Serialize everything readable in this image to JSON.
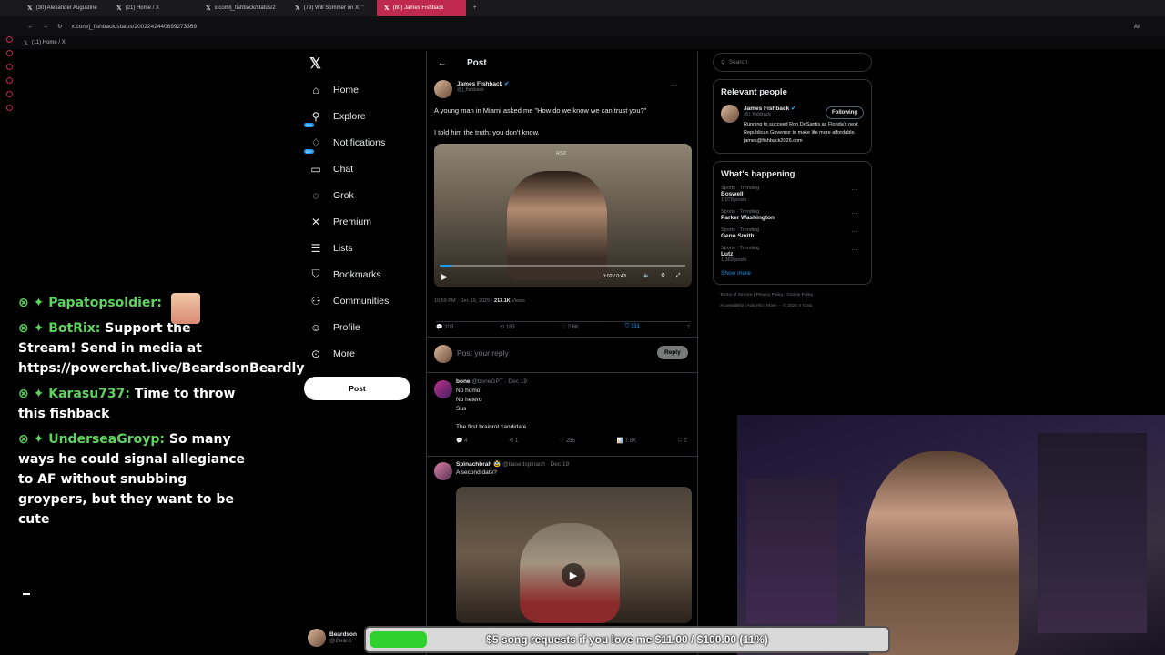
{
  "browser": {
    "tabs": [
      {
        "label": "(30) Alexander Augustine"
      },
      {
        "label": "(21) Home / X"
      },
      {
        "label": "x.com/j_fishback/status/2"
      },
      {
        "label": "(79) Will Sommer on X: \""
      },
      {
        "label": "(80) James Fishback"
      }
    ],
    "url": "x.com/j_fishback/status/2002242440699273369",
    "bookmark": "(11) Home / X",
    "ai_label": "AI"
  },
  "nav": {
    "items": [
      {
        "label": "Home",
        "icon": "home-icon",
        "glyph": "⌂"
      },
      {
        "label": "Explore",
        "icon": "search-icon",
        "glyph": "⚲"
      },
      {
        "label": "Notifications",
        "icon": "bell-icon",
        "glyph": "♢",
        "badge": "20+"
      },
      {
        "label": "Chat",
        "icon": "chat-icon",
        "glyph": "▭",
        "badge": "20+"
      },
      {
        "label": "Grok",
        "icon": "grok-icon",
        "glyph": "◌"
      },
      {
        "label": "Premium",
        "icon": "x-logo-icon",
        "glyph": "✕"
      },
      {
        "label": "Lists",
        "icon": "list-icon",
        "glyph": "☰"
      },
      {
        "label": "Bookmarks",
        "icon": "bookmark-icon",
        "glyph": "⛉"
      },
      {
        "label": "Communities",
        "icon": "communities-icon",
        "glyph": "⚇"
      },
      {
        "label": "Profile",
        "icon": "profile-icon",
        "glyph": "☺"
      },
      {
        "label": "More",
        "icon": "more-icon",
        "glyph": "⊙"
      }
    ],
    "post_button": "Post"
  },
  "post": {
    "header": "Post",
    "author": "James Fishback",
    "handle": "@j_fishback",
    "text1": "A young man in Miami asked me \"How do we know we can trust you?\"",
    "text2": "I told him the truth: you don't know.",
    "video_time": "0:02 / 0:43",
    "video_badge": "RSX",
    "time": "10:59 PM · Dec 19, 2025 ·",
    "views": "213.1K",
    "views_label": "Views",
    "replies": "208",
    "reposts": "183",
    "likes": "2.6K",
    "bookmarks": "331",
    "reply_placeholder": "Post your reply",
    "reply_button": "Reply"
  },
  "replies": [
    {
      "author": "bone",
      "handle": "@boneGPT · Dec 19",
      "lines": [
        "No homo",
        "No hetero",
        "Sus",
        "",
        "The first brainrot candidate"
      ],
      "replies": "4",
      "reposts": "1",
      "likes": "285",
      "views": "7.8K"
    },
    {
      "author": "Spinachbrah 🥸",
      "handle": "@basedspinach · Dec 19",
      "lines": [
        "A second date?"
      ]
    }
  ],
  "right": {
    "search_placeholder": "Search",
    "relevant_title": "Relevant people",
    "person_name": "James Fishback",
    "person_handle": "@j_fishback",
    "person_button": "Following",
    "person_bio": "Running to succeed Ron DeSantis as Florida's next Republican Governor to make life more affordable. james@fishback2026.com",
    "happening_title": "What's happening",
    "trends": [
      {
        "meta": "Sports · Trending",
        "name": "Boswell",
        "posts": "1,078 posts"
      },
      {
        "meta": "Sports · Trending",
        "name": "Parker Washington",
        "posts": ""
      },
      {
        "meta": "Sports · Trending",
        "name": "Geno Smith",
        "posts": ""
      },
      {
        "meta": "Sports · Trending",
        "name": "Lutz",
        "posts": "1,369 posts"
      }
    ],
    "show_more": "Show more",
    "footer1": "Terms of Service  |  Privacy Policy  |  Cookie Policy  |",
    "footer2": "Accessibility  |  Ads info  |  More ···  © 2025 X Corp."
  },
  "chat": [
    {
      "user": "Papatopsoldier:",
      "msg": ""
    },
    {
      "user": "BotRix:",
      "msg": "Support the Stream! Send in media at https://powerchat.live/BeardsonBeardly"
    },
    {
      "user": "Karasu737:",
      "msg": "Time to throw this fishback"
    },
    {
      "user": "UnderseaGroyp:",
      "msg": "So many ways he could signal allegiance to AF without snubbing groypers, but they want to be cute"
    }
  ],
  "overlay": {
    "streamer_name": "Beardson",
    "streamer_handle": "@Beard",
    "goal_text": "$5 song requests if you love me $11.00 / $100.00 (11%)",
    "goal_progress": 0.11,
    "goal_color": "#2ed12e"
  },
  "colors": {
    "accent": "#1d9bf0",
    "tab_active": "#c0294e",
    "chat_user": "#5fd35f"
  }
}
